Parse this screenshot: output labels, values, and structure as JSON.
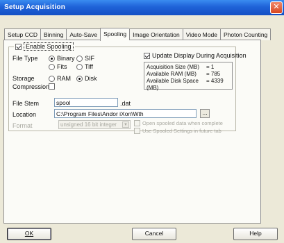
{
  "window": {
    "title": "Setup Acquisition"
  },
  "tabs": [
    {
      "label": "Setup CCD",
      "active": false
    },
    {
      "label": "Binning",
      "active": false
    },
    {
      "label": "Auto-Save",
      "active": false
    },
    {
      "label": "Spooling",
      "active": true
    },
    {
      "label": "Image Orientation",
      "active": false
    },
    {
      "label": "Video Mode",
      "active": false
    },
    {
      "label": "Photon Counting",
      "active": false
    }
  ],
  "spooling": {
    "enable_label": "Enable Spooling",
    "enable_checked": true,
    "file_type_label": "File Type",
    "file_type_options": [
      "Binary",
      "SIF",
      "Fits",
      "Tiff"
    ],
    "file_type_selected": "Binary",
    "storage_label": "Storage",
    "storage_options": [
      "RAM",
      "Disk"
    ],
    "storage_selected": "Disk",
    "compression_label": "Compression",
    "compression_checked": false,
    "update_display_label": "Update Display During Acquisition",
    "update_display_checked": true,
    "info": {
      "acq_size_label": "Acquisition Size (MB)",
      "acq_size_value": "= 1",
      "ram_label": "Available RAM (MB)",
      "ram_value": "= 785",
      "disk_label": "Available Disk Space (MB)",
      "disk_value": "= 4339"
    }
  },
  "file_stem": {
    "label": "File Stem",
    "value": "spool",
    "extension": ".dat"
  },
  "location": {
    "label": "Location",
    "value": "C:\\Program Files\\Andor iXon\\Wth",
    "browse_label": "..."
  },
  "format": {
    "label": "Format",
    "value": "unsigned 16 bit integer",
    "option1": "Open spooled data when complete",
    "option2": "Use Spooled Settings in future tab"
  },
  "buttons": {
    "ok": "OK",
    "cancel": "Cancel",
    "help": "Help"
  },
  "colors": {
    "titlebar": "#1f62d8",
    "dialog_bg": "#ece9d8",
    "panel_bg": "#fbfbf7",
    "close_button": "#d8461f"
  },
  "icons": {
    "close": "close-icon",
    "combo_arrow": "chevron-down-icon"
  }
}
